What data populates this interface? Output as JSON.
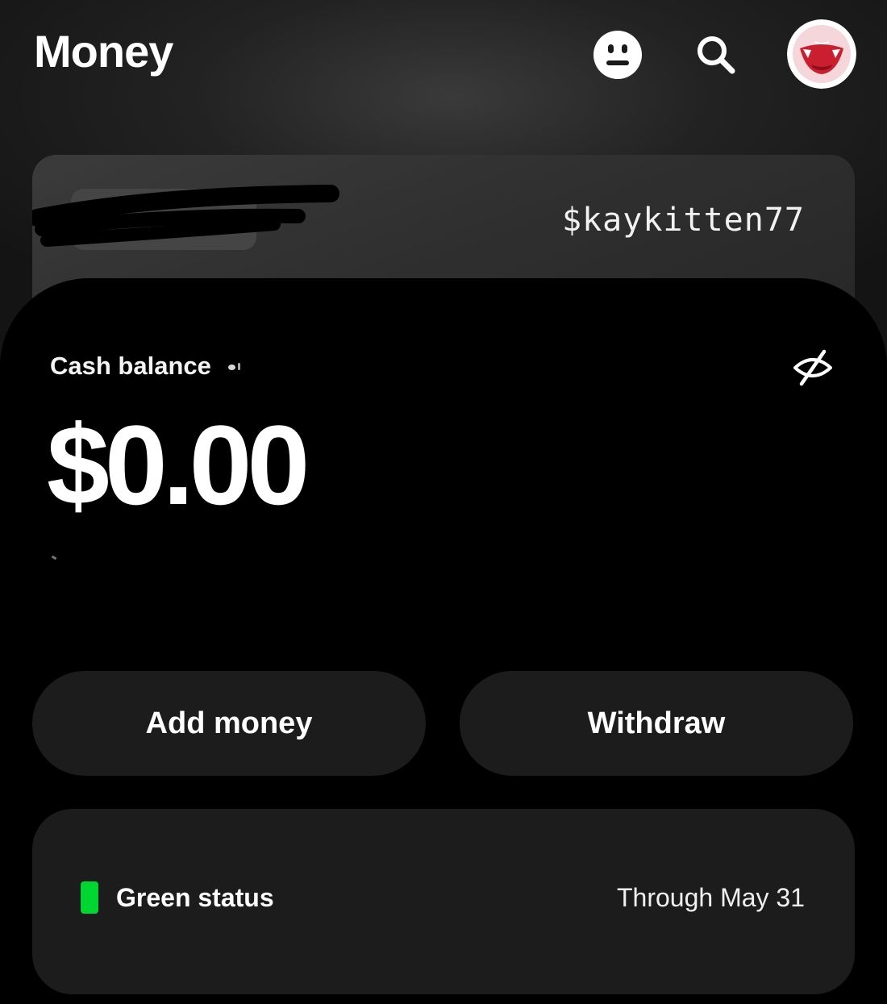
{
  "header": {
    "title": "Money",
    "icons": {
      "support": "smiley-icon",
      "search": "search-icon",
      "profile": "avatar"
    }
  },
  "cash_card": {
    "cashtag": "$kaykitten77"
  },
  "balance": {
    "label": "Cash balance",
    "amount": "$0.00",
    "visibility_icon": "eye-slash-icon"
  },
  "actions": {
    "add_money_label": "Add money",
    "withdraw_label": "Withdraw"
  },
  "status": {
    "label": "Green status",
    "date": "Through May 31",
    "indicator_color": "#00d632"
  },
  "colors": {
    "accent_green": "#00d632",
    "panel_black": "#000000",
    "button_gray": "#1c1c1c"
  }
}
